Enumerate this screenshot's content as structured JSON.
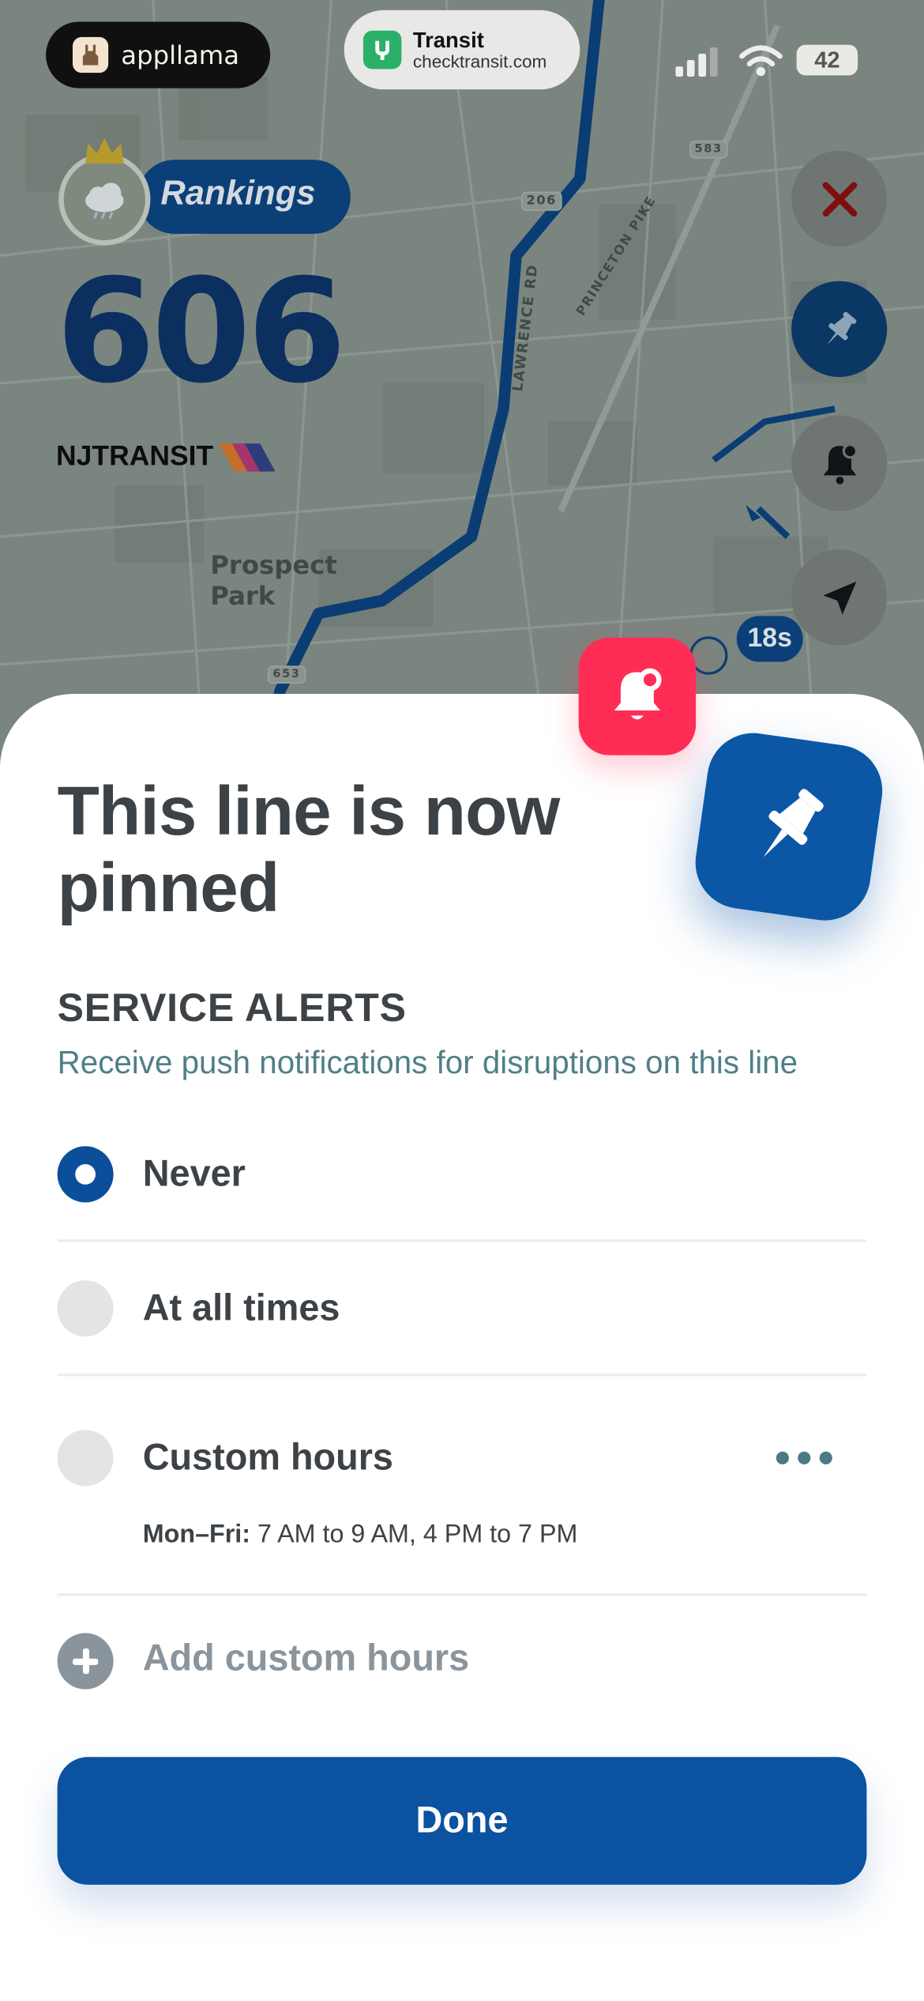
{
  "status_bar": {
    "left_app": "appllama",
    "center_app_name": "Transit",
    "center_app_url": "checktransit.com",
    "battery": "42"
  },
  "map": {
    "rankings_label": "Rankings",
    "route_number": "606",
    "agency": "NJTRANSIT",
    "road_labels": [
      "LAWRENCE RD",
      "PRINCETON PIKE",
      "206",
      "583",
      "653"
    ],
    "place_label": "Prospect Park",
    "eta": "18s",
    "icons": [
      "close-icon",
      "pin-icon",
      "bell-icon",
      "location-arrow-icon"
    ]
  },
  "sheet": {
    "title": "This line is now pinned",
    "section_title": "SERVICE ALERTS",
    "section_subtitle": "Receive push notifications for disruptions on this line",
    "options": [
      {
        "label": "Never",
        "selected": true
      },
      {
        "label": "At all times",
        "selected": false
      },
      {
        "label": "Custom hours",
        "selected": false
      }
    ],
    "custom_hours_days": "Mon–Fri:",
    "custom_hours_times": "7 AM to 9 AM, 4 PM to 7 PM",
    "add_label": "Add custom hours",
    "done_label": "Done"
  },
  "colors": {
    "primary": "#0b52a0",
    "accent_pink": "#ff2d55",
    "text": "#3d4247",
    "subtitle": "#4f7f87"
  }
}
